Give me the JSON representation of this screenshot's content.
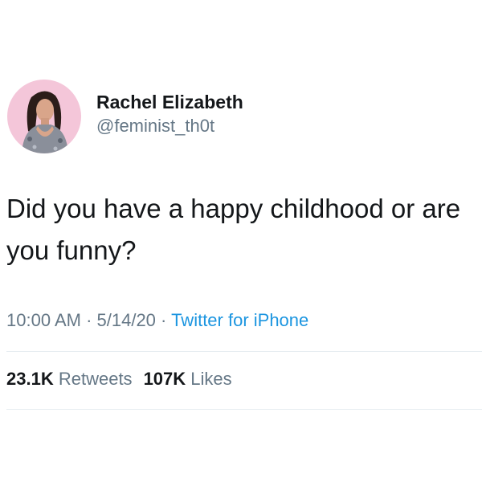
{
  "author": {
    "display_name": "Rachel Elizabeth",
    "handle": "@feminist_th0t"
  },
  "tweet": {
    "text": "Did you have a happy childhood or are you funny?"
  },
  "meta": {
    "time": "10:00 AM",
    "separator": " · ",
    "date": "5/14/20",
    "client": "Twitter for iPhone"
  },
  "stats": {
    "retweets_count": "23.1K",
    "retweets_label": "Retweets",
    "likes_count": "107K",
    "likes_label": "Likes"
  },
  "colors": {
    "text_primary": "#14171a",
    "text_secondary": "#657786",
    "link_blue": "#1b95e0",
    "divider": "#e6ecf0",
    "avatar_background": "#f4c6d9"
  }
}
